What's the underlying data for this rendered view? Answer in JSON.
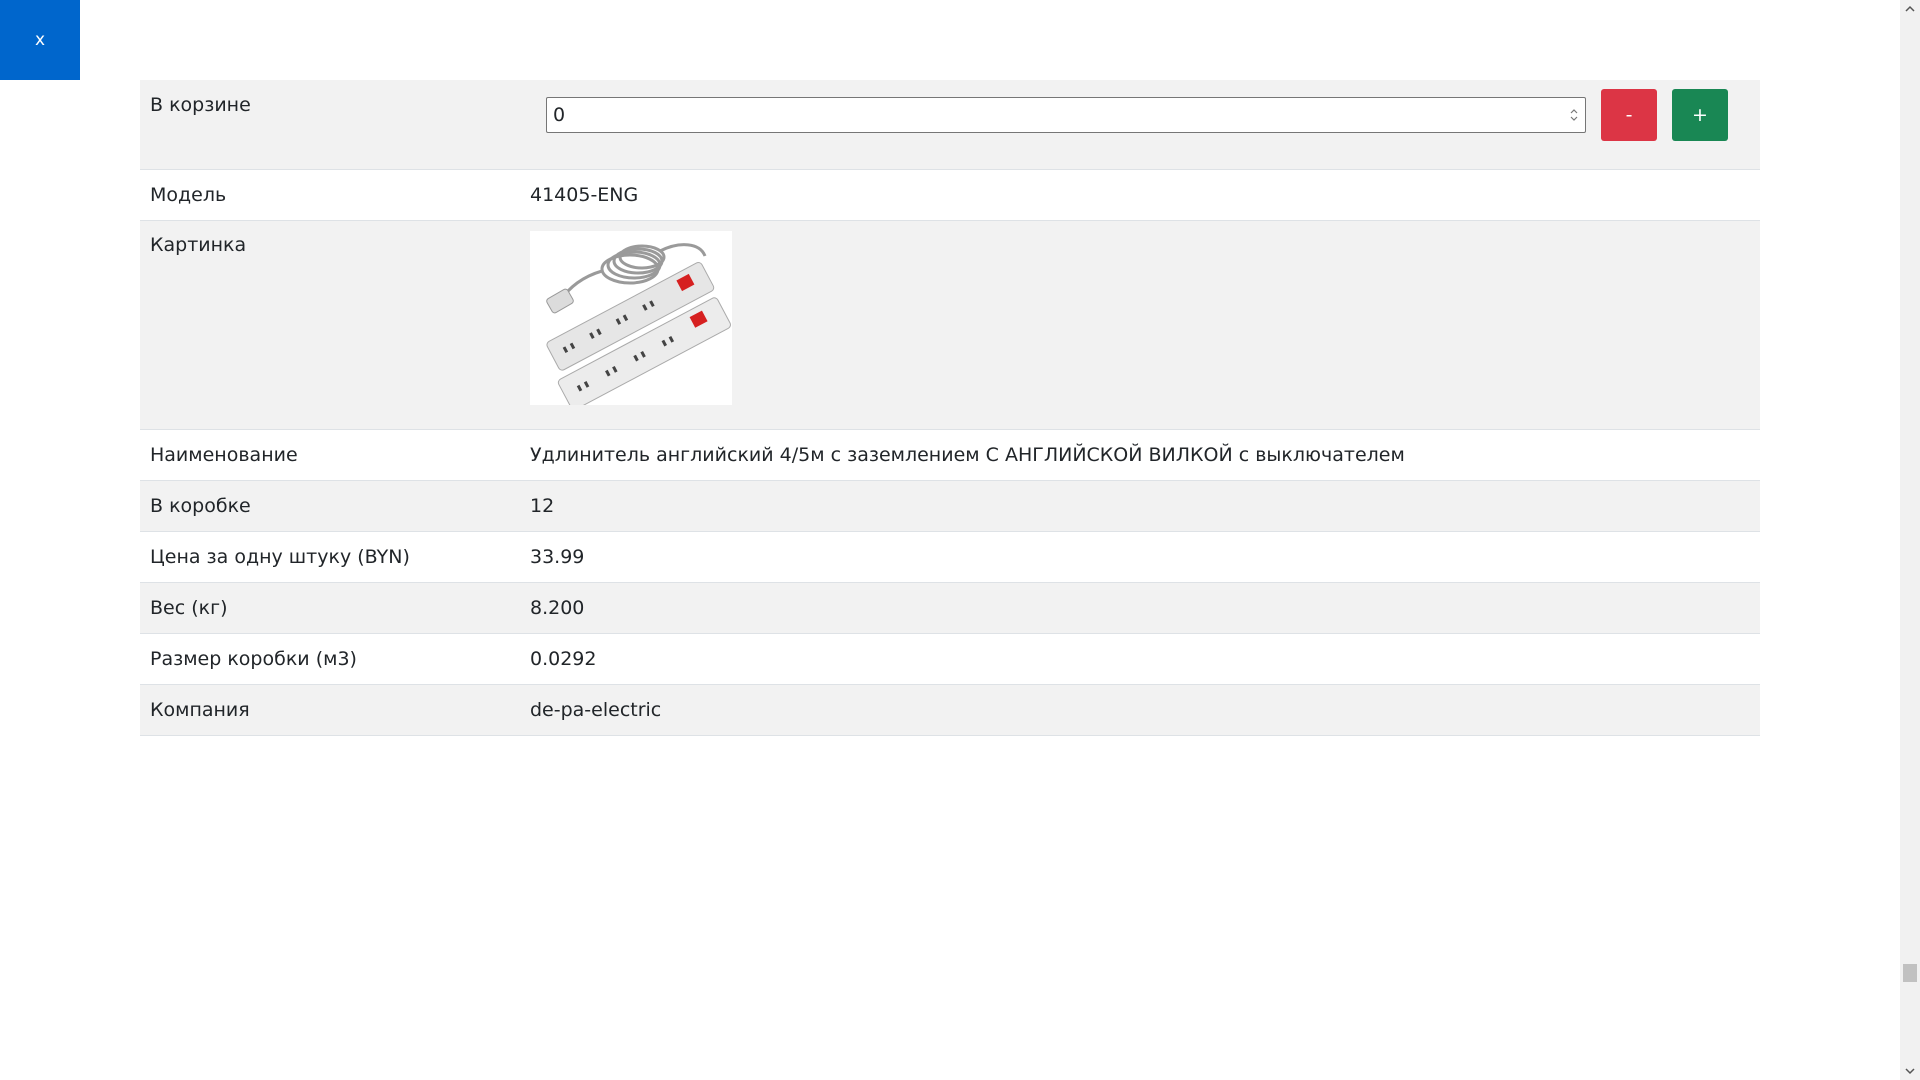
{
  "close_button": {
    "label": "x"
  },
  "basket": {
    "label": "В корзине",
    "quantity": "0",
    "minus_label": "-",
    "plus_label": "+"
  },
  "rows": {
    "model": {
      "label": "Модель",
      "value": "41405-ENG"
    },
    "picture": {
      "label": "Картинка",
      "image_desc": "power-strip-image"
    },
    "name": {
      "label": "Наименование",
      "value": "Удлинитель английский 4/5м с заземлением С АНГЛИЙСКОЙ ВИЛКОЙ с выключателем"
    },
    "box_qty": {
      "label": "В коробке",
      "value": "12"
    },
    "price": {
      "label": "Цена за одну штуку (BYN)",
      "value": "33.99"
    },
    "weight": {
      "label": "Вес (кг)",
      "value": "8.200"
    },
    "box_size": {
      "label": "Размер коробки (м3)",
      "value": "0.0292"
    },
    "company": {
      "label": "Компания",
      "value": "de-pa-electric"
    }
  },
  "colors": {
    "close_bg": "#0066cc",
    "minus_bg": "#dc3545",
    "plus_bg": "#198754",
    "row_stripe": "#f2f2f2"
  },
  "icons": {
    "spinner": "spinner-arrows-icon",
    "scroll_up": "chevron-up-icon",
    "scroll_down": "chevron-down-icon"
  }
}
